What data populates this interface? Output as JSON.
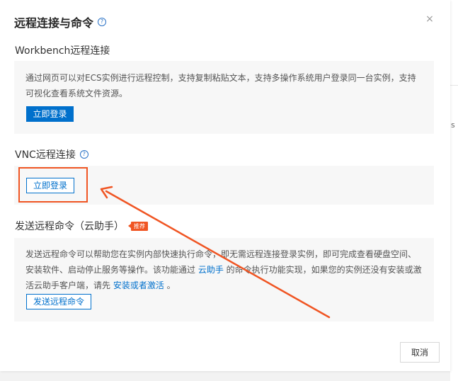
{
  "dialog": {
    "title": "远程连接与命令",
    "help_glyph": "?",
    "close_glyph": "×"
  },
  "workbench": {
    "heading": "Workbench远程连接",
    "description": "通过网页可以对ECS实例进行远程控制，支持复制粘贴文本，支持多操作系统用户登录同一台实例，支持可视化查看系统文件资源。",
    "login_button": "立即登录"
  },
  "vnc": {
    "heading": "VNC远程连接",
    "help_glyph": "?",
    "login_button": "立即登录"
  },
  "cloud_assistant": {
    "heading": "发送远程命令（云助手）",
    "badge": "推荐",
    "desc_part1": "发送远程命令可以帮助您在实例内部快速执行命令，即无需远程连接登录实例，即可完成查看硬盘空间、安装软件、启动停止服务等操作。该功能通过 ",
    "link_cloud_assistant": "云助手",
    "desc_part2": " 的命令执行功能实现，如果您的实例还没有安装或激活云助手客户端，请先 ",
    "link_install": "安装或者激活",
    "desc_part3": " 。",
    "send_button": "发送远程命令"
  },
  "footer": {
    "cancel_button": "取消"
  },
  "background": {
    "partial_text": "s"
  },
  "colors": {
    "primary": "#0070cc",
    "annotation": "#f05523",
    "badge": "#f05523"
  }
}
